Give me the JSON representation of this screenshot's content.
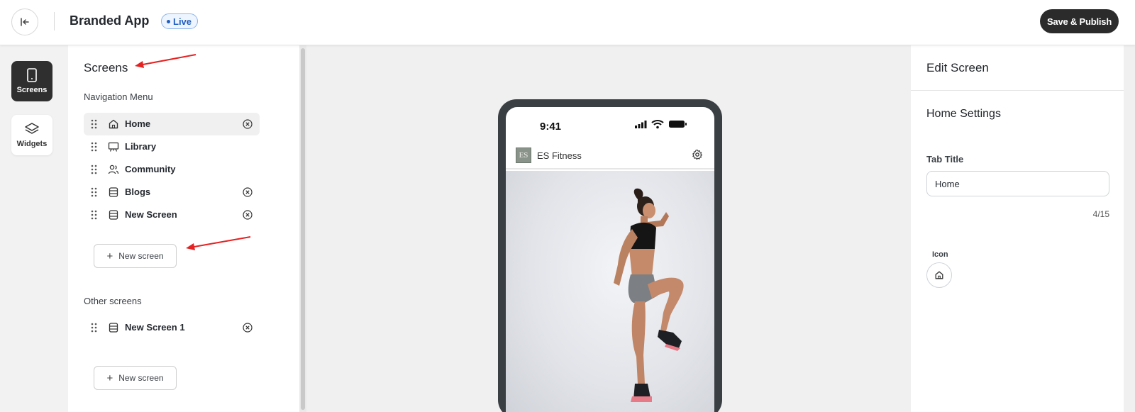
{
  "header": {
    "app_title": "Branded App",
    "status_badge": "Live",
    "publish_label": "Save & Publish"
  },
  "rail": {
    "items": [
      {
        "label": "Screens",
        "icon": "phone-icon",
        "active": true
      },
      {
        "label": "Widgets",
        "icon": "layers-icon",
        "active": false
      }
    ]
  },
  "screens_panel": {
    "title": "Screens",
    "navigation_label": "Navigation Menu",
    "navigation_items": [
      {
        "label": "Home",
        "icon": "home-icon",
        "selected": true,
        "removable": true
      },
      {
        "label": "Library",
        "icon": "presentation-icon",
        "selected": false,
        "removable": false
      },
      {
        "label": "Community",
        "icon": "users-icon",
        "selected": false,
        "removable": false
      },
      {
        "label": "Blogs",
        "icon": "database-icon",
        "selected": false,
        "removable": true
      },
      {
        "label": "New Screen",
        "icon": "database-icon",
        "selected": false,
        "removable": true
      }
    ],
    "new_screen_label": "New screen",
    "other_label": "Other screens",
    "other_items": [
      {
        "label": "New Screen 1",
        "icon": "database-icon",
        "removable": true
      }
    ],
    "new_screen_label_2": "New screen"
  },
  "preview": {
    "status_time": "9:41",
    "brand_logo_text": "ES",
    "brand_name": "ES Fitness",
    "hero_image": "fitness-woman-high-knee-photo"
  },
  "edit_panel": {
    "title": "Edit Screen",
    "section_title": "Home Settings",
    "tab_title_label": "Tab Title",
    "tab_title_value": "Home",
    "char_count": "4/15",
    "icon_label": "Icon",
    "selected_icon": "home-icon"
  },
  "colors": {
    "primary_button": "#2b2b2b",
    "live_badge": "#1f5fbf",
    "annotation_arrow": "#e52222",
    "phone_frame": "#3a3f43"
  }
}
